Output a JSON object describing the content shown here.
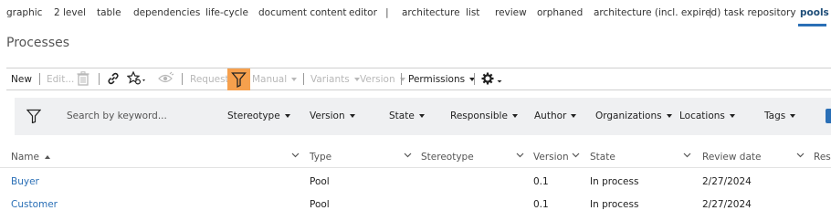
{
  "topnav": {
    "items": [
      "graphic",
      "2 level",
      "table",
      "dependencies",
      "life-cycle",
      "document content",
      "editor",
      "architecture",
      "list",
      "review",
      "orphaned",
      "architecture (incl. expired)",
      "task repository",
      "pools"
    ],
    "separator": "|",
    "active_index": 13
  },
  "page": {
    "title": "Processes"
  },
  "toolbar": {
    "new_label": "New",
    "edit_label": "Edit...",
    "request_label": "Request",
    "manual_label": "Manual",
    "variants_label": "Variants",
    "version_label": "Version",
    "permissions_label": "Permissions",
    "icons": [
      "delete-icon",
      "link-icon",
      "star-settings-icon",
      "eye-icon",
      "filter-icon",
      "gear-icon"
    ],
    "active_color": "#f6a04d"
  },
  "filterbar": {
    "search_placeholder": "Search by keyword...",
    "dropdowns": [
      "Stereotype",
      "Version",
      "State",
      "Responsible",
      "Author",
      "Organizations",
      "Locations",
      "Tags"
    ],
    "accent": "#2a6fb6"
  },
  "table": {
    "columns": [
      "Name",
      "Type",
      "Stereotype",
      "Version",
      "State",
      "Review date",
      "Resp"
    ],
    "sorted_column": "Name",
    "rows": [
      {
        "name": "Buyer",
        "type": "Pool",
        "stereotype": "",
        "version": "0.1",
        "state": "In process",
        "review_date": "2/27/2024"
      },
      {
        "name": "Customer",
        "type": "Pool",
        "stereotype": "",
        "version": "0.1",
        "state": "In process",
        "review_date": "2/27/2024"
      }
    ]
  }
}
